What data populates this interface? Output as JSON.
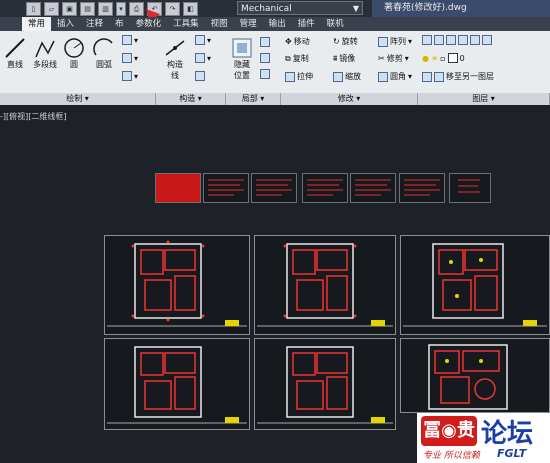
{
  "workspace": "Mechanical",
  "filename": "著春苑(修改好).dwg",
  "tabs": [
    "常用",
    "插入",
    "注释",
    "布",
    "参数化",
    "工具集",
    "视图",
    "管理",
    "输出",
    "插件",
    "联机"
  ],
  "ribbon": {
    "draw": {
      "line": "直线",
      "polyline": "多段线",
      "circle": "圆",
      "arc": "圆弧",
      "panel": "绘制"
    },
    "construct": {
      "label": "构造",
      "sub": "线",
      "panel": "构造"
    },
    "section": {
      "hide": "隐藏",
      "position": "位置",
      "panel": "局部"
    },
    "modify": {
      "move": "移动",
      "rotate": "旋转",
      "array": "阵列",
      "copy": "复制",
      "mirror": "镜像",
      "trim": "修剪",
      "stretch": "拉伸",
      "scale": "缩放",
      "fillet": "圆角",
      "panel": "修改"
    },
    "layers": {
      "value": "0",
      "move_to": "移至另一图层",
      "panel": "图层"
    }
  },
  "view_label": "-][俯视][二维线框]",
  "watermark": {
    "brand": "论坛",
    "sub": "FGLT",
    "tagline": "专业 所以信赖"
  }
}
